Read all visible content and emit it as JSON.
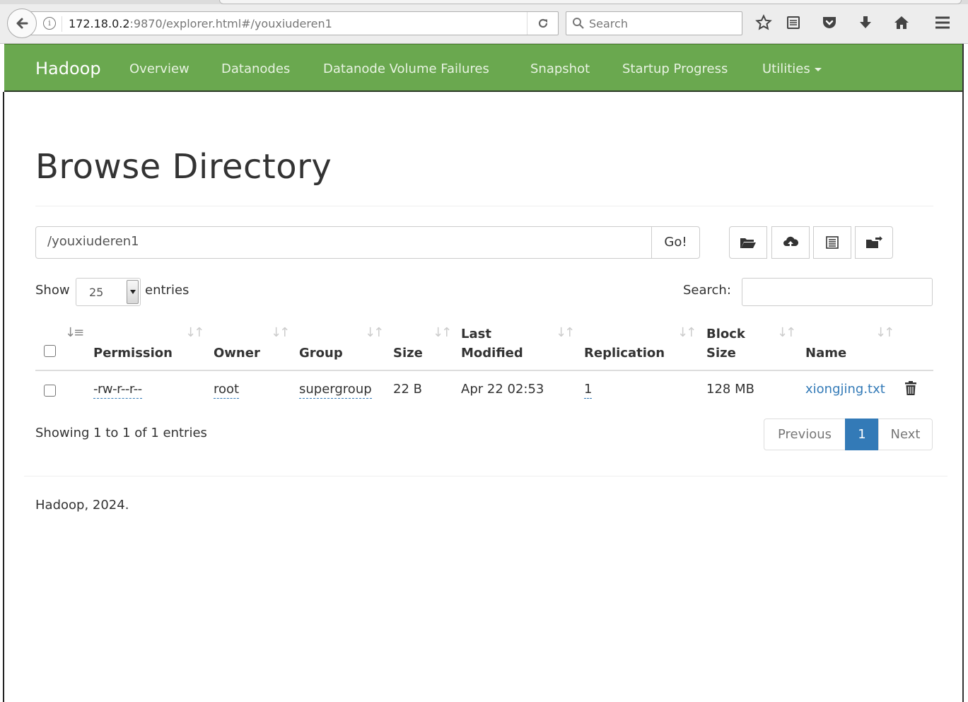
{
  "browser": {
    "url_host": "172.18.0.2",
    "url_rest": ":9870/explorer.html#/youxiuderen1",
    "search_placeholder": "Search"
  },
  "navbar": {
    "brand": "Hadoop",
    "items": [
      "Overview",
      "Datanodes",
      "Datanode Volume Failures",
      "Snapshot",
      "Startup Progress",
      "Utilities"
    ],
    "color": "#6aa84f"
  },
  "page": {
    "title": "Browse Directory",
    "path_value": "/youxiuderen1",
    "go_label": "Go!"
  },
  "table_controls": {
    "show_label": "Show",
    "page_length": "25",
    "entries_label": "entries",
    "search_label": "Search:"
  },
  "table": {
    "columns": [
      "Permission",
      "Owner",
      "Group",
      "Size",
      "Last",
      "Modified",
      "Replication",
      "Block",
      "Size",
      "Name"
    ],
    "rows": [
      {
        "permission": "-rw-r--r--",
        "owner": "root",
        "group": "supergroup",
        "size": "22 B",
        "last_modified": "Apr 22 02:53",
        "replication": "1",
        "block_size": "128 MB",
        "name": "xiongjing.txt"
      }
    ]
  },
  "pagination": {
    "info": "Showing 1 to 1 of 1 entries",
    "previous": "Previous",
    "current": "1",
    "next": "Next"
  },
  "footer": "Hadoop, 2024.",
  "colors": {
    "link": "#337ab7",
    "active_page": "#337ab7"
  }
}
